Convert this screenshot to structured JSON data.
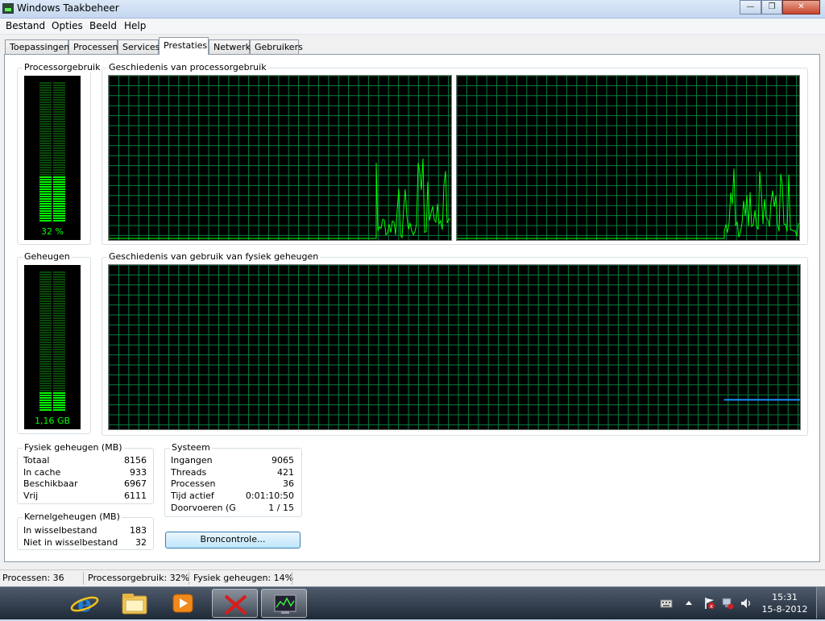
{
  "window": {
    "title": "Windows Taakbeheer"
  },
  "menu": [
    "Bestand",
    "Opties",
    "Beeld",
    "Help"
  ],
  "tabs": [
    "Toepassingen",
    "Processen",
    "Services",
    "Prestaties",
    "Netwerk",
    "Gebruikers"
  ],
  "active_tab": "Prestaties",
  "cpu_usage": {
    "title": "Processorgebruik",
    "value": "32 %",
    "level": 0.32
  },
  "cpu_history": {
    "title": "Geschiedenis van processorgebruik"
  },
  "memory_usage": {
    "title": "Geheugen",
    "value": "1,16 GB",
    "level": 0.14
  },
  "memory_history": {
    "title": "Geschiedenis van gebruik van fysiek geheugen",
    "level": 0.14
  },
  "physical_memory": {
    "title": "Fysiek geheugen (MB)",
    "rows": [
      {
        "label": "Totaal",
        "value": "8156"
      },
      {
        "label": "In cache",
        "value": "933"
      },
      {
        "label": "Beschikbaar",
        "value": "6967"
      },
      {
        "label": "Vrij",
        "value": "6111"
      }
    ]
  },
  "kernel_memory": {
    "title": "Kernelgeheugen (MB)",
    "rows": [
      {
        "label": "In wisselbestand",
        "value": "183"
      },
      {
        "label": "Niet in wisselbestand",
        "value": "32"
      }
    ]
  },
  "system": {
    "title": "Systeem",
    "rows": [
      {
        "label": "Ingangen",
        "value": "9065"
      },
      {
        "label": "Threads",
        "value": "421"
      },
      {
        "label": "Processen",
        "value": "36"
      },
      {
        "label": "Tijd actief",
        "value": "0:01:10:50"
      },
      {
        "label": "Doorvoeren (G",
        "value": "1 / 15"
      }
    ]
  },
  "resource_button": "Broncontrole...",
  "statusbar": {
    "processes": "Processen: 36",
    "cpu": "Processorgebruik: 32%",
    "memory": "Fysiek geheugen: 14%"
  },
  "taskbar": {
    "apps": [
      "internet-explorer-icon",
      "windows-explorer-icon",
      "media-player-icon",
      "app-x-icon",
      "task-manager-icon"
    ],
    "tray": [
      "keyboard-icon",
      "show-hidden-icons-arrow",
      "action-center-icon",
      "network-icon",
      "volume-icon"
    ]
  },
  "clock": {
    "time": "15:31",
    "date": "15-8-2012"
  },
  "colors": {
    "graph_line": "#00ff00",
    "grid": "#008040",
    "memory_line": "#1e90ff"
  }
}
